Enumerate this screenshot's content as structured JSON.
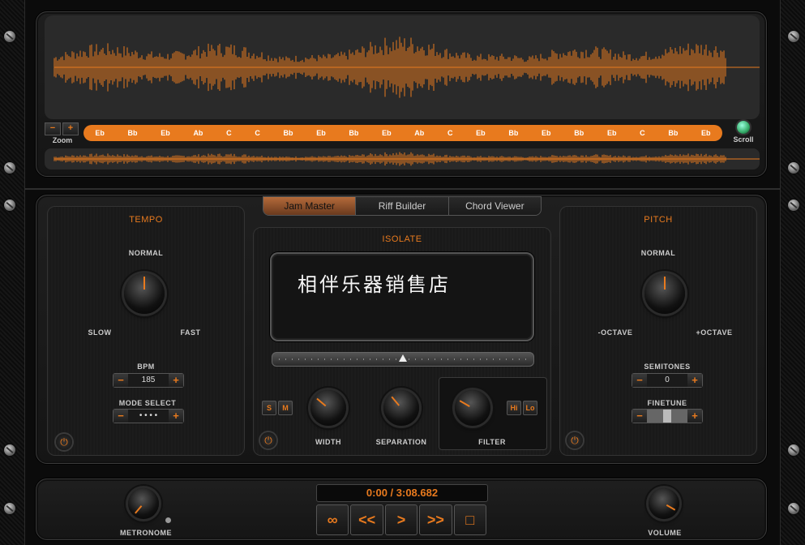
{
  "overview": {
    "zoom_label": "Zoom",
    "zoom_minus": "−",
    "zoom_plus": "+",
    "scroll_label": "Scroll",
    "chords": [
      "Eb",
      "Bb",
      "Eb",
      "Ab",
      "C",
      "C",
      "Bb",
      "Eb",
      "Bb",
      "Eb",
      "Ab",
      "C",
      "Eb",
      "Bb",
      "Eb",
      "Bb",
      "Eb",
      "C",
      "Bb",
      "Eb"
    ]
  },
  "tabs": [
    {
      "label": "Jam Master"
    },
    {
      "label": "Riff Builder"
    },
    {
      "label": "Chord Viewer"
    }
  ],
  "tempo": {
    "title": "TEMPO",
    "normal": "NORMAL",
    "slow": "SLOW",
    "fast": "FAST",
    "bpm_label": "BPM",
    "bpm_value": "185",
    "mode_label": "MODE SELECT",
    "mode_value": "• • • •",
    "minus": "−",
    "plus": "+",
    "power": "⏻"
  },
  "isolate": {
    "title": "ISOLATE",
    "display_text": "相伴乐器销售店",
    "s": "S",
    "m": "M",
    "width_label": "WIDTH",
    "separation_label": "SEPARATION",
    "filter_label": "FILTER",
    "hi": "Hi",
    "lo": "Lo",
    "power": "⏻"
  },
  "pitch": {
    "title": "PITCH",
    "normal": "NORMAL",
    "minus_octave": "-OCTAVE",
    "plus_octave": "+OCTAVE",
    "semitones_label": "SEMITONES",
    "semitones_value": "0",
    "finetune_label": "FINETUNE",
    "minus": "−",
    "plus": "+",
    "power": "⏻"
  },
  "transport": {
    "time": "0:00 / 3:08.682",
    "loop": "∞",
    "rewind": "<<",
    "play": ">",
    "forward": ">>",
    "stop": "□",
    "metronome_label": "METRONOME",
    "volume_label": "VOLUME"
  },
  "colors": {
    "accent": "#e87a1e",
    "panel": "#1a1a1a"
  }
}
